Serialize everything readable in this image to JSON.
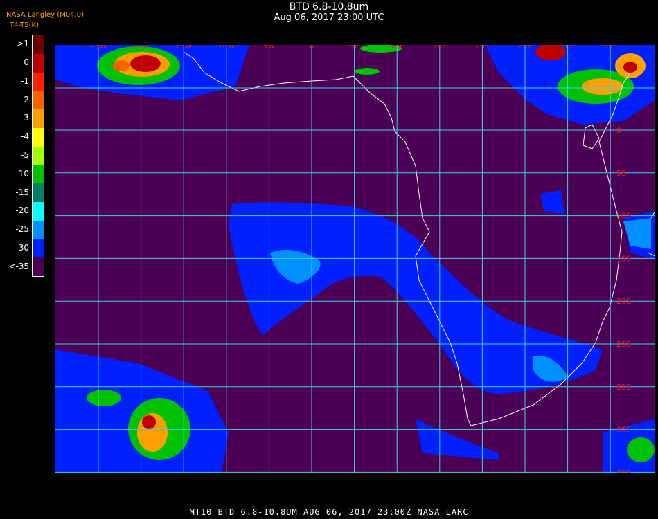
{
  "header": {
    "title": "BTD 6.8-10.8um",
    "subtitle": "Aug 06, 2017 23:00 UTC",
    "credit": "NASA Langley (M04.0)",
    "units": "T4-T5(K)",
    "units_prefix": "BTD"
  },
  "legend": {
    "entries": [
      {
        "label": ">1",
        "color": "#6b0000"
      },
      {
        "label": "0",
        "color": "#c00000"
      },
      {
        "label": "-1",
        "color": "#ff2000"
      },
      {
        "label": "-2",
        "color": "#ff6000"
      },
      {
        "label": "-3",
        "color": "#ffa000"
      },
      {
        "label": "-4",
        "color": "#ffff00"
      },
      {
        "label": "-5",
        "color": "#a0ff00"
      },
      {
        "label": "-10",
        "color": "#00c000"
      },
      {
        "label": "-15",
        "color": "#008060"
      },
      {
        "label": "-20",
        "color": "#00ffff"
      },
      {
        "label": "-25",
        "color": "#0090ff"
      },
      {
        "label": "-30",
        "color": "#0020ff"
      },
      {
        "label": "<-35",
        "color": "#4b0055"
      }
    ]
  },
  "grid": {
    "lon_labels": [
      "25W",
      "20W",
      "15W",
      "10W",
      "5W",
      "0",
      "5E",
      "10E",
      "15E",
      "20E",
      "25E",
      "30E",
      "35E"
    ],
    "lat_labels": [
      "0",
      "5S",
      "10S",
      "15S",
      "20S",
      "25S",
      "30S",
      "35S",
      "40S"
    ]
  },
  "colors": {
    "background": "#4b0055",
    "grid": "#40d0e0",
    "coast": "#ffffff",
    "grid_label": "#e02020"
  },
  "footer": {
    "text": "MT10  BTD 6.8-10.8UM   AUG 06, 2017 23:00Z   NASA LARC"
  }
}
